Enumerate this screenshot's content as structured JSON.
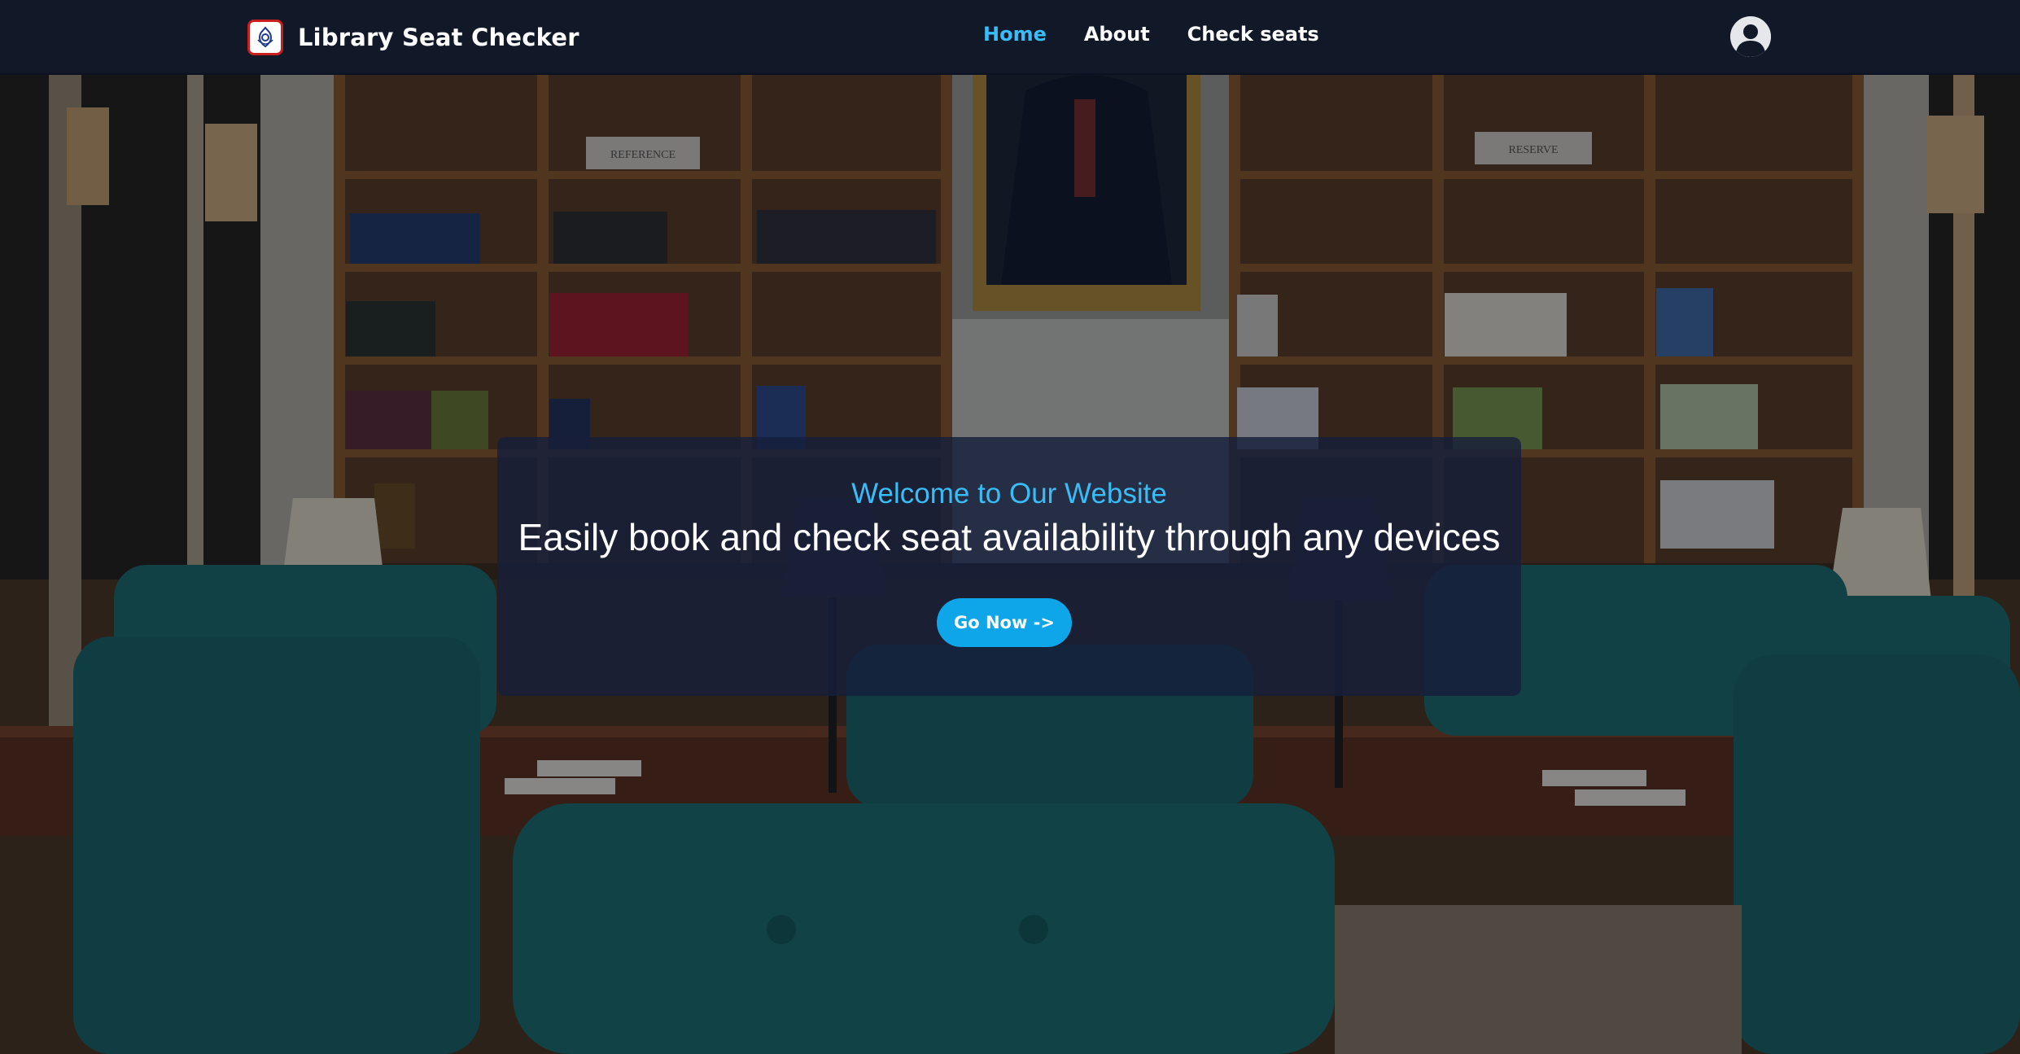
{
  "brand": {
    "name": "Library Seat Checker",
    "logo_icon": "library-logo-icon"
  },
  "nav": {
    "items": [
      {
        "label": "Home",
        "active": true
      },
      {
        "label": "About",
        "active": false
      },
      {
        "label": "Check seats",
        "active": false
      }
    ]
  },
  "user": {
    "avatar_icon": "user-avatar-icon"
  },
  "hero": {
    "background": "library-reading-room-photo",
    "shelf_labels": [
      "Reference",
      "Reserve"
    ],
    "welcome_text": "Welcome to Our Website",
    "headline": "Easily book and check seat availability through any devices",
    "cta_label": "Go Now ->"
  },
  "colors": {
    "navbar": "#111827",
    "accent": "#38bdf8",
    "button": "#0ea5e9",
    "card": "#161e3a",
    "chair_teal": "#0f5a5e"
  }
}
